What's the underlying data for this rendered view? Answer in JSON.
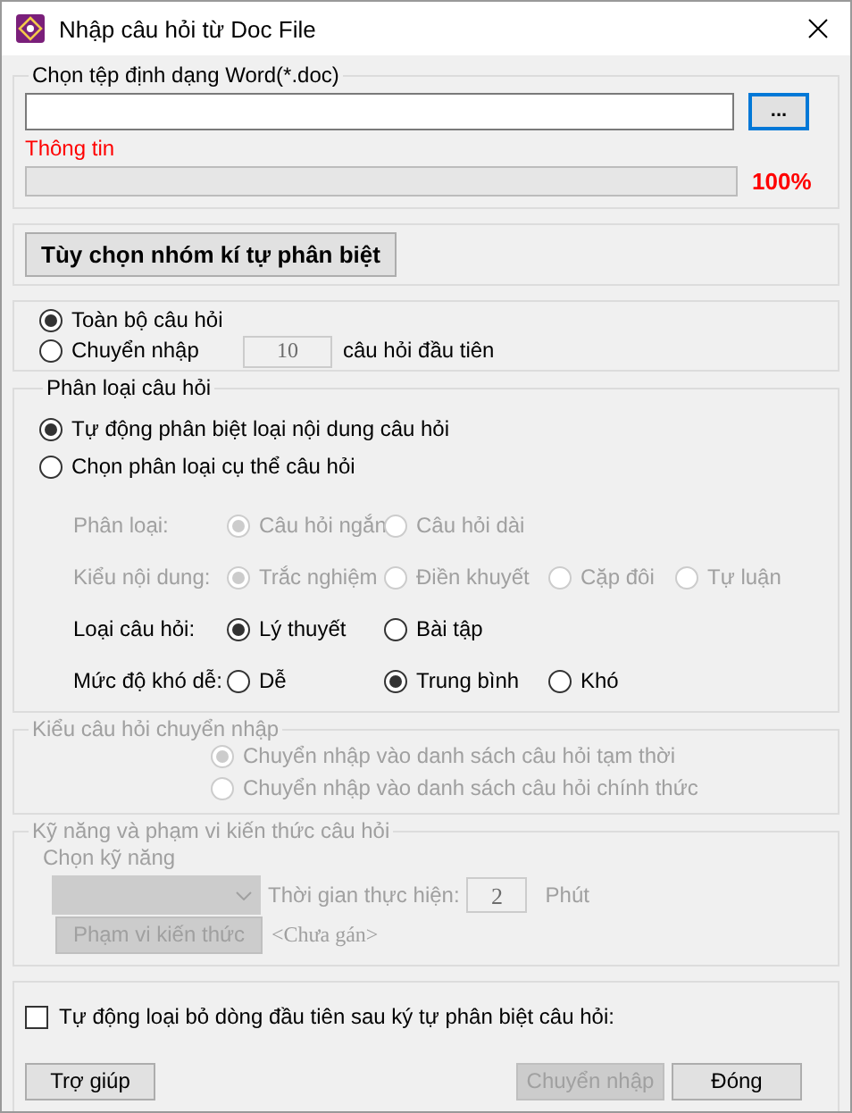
{
  "window": {
    "title": "Nhập câu hỏi từ Doc File"
  },
  "file_group": {
    "legend": "Chọn tệp định dạng Word(*.doc)",
    "browse_button": "...",
    "info_label": "Thông tin",
    "progress": {
      "reading": "100%"
    }
  },
  "options_button": {
    "label": "Tùy chọn nhóm kí tự phân biệt"
  },
  "scope": [
    {
      "label": "Toàn bộ câu hỏi",
      "selected": true
    },
    {
      "label": "Chuyển nhập",
      "selected": false,
      "count": "10",
      "suffix": "câu hỏi đầu tiên"
    }
  ],
  "classification": {
    "legend": "Phân loại câu hỏi",
    "modes": [
      {
        "label": "Tự động phân biệt loại nội dung câu hỏi",
        "selected": true
      },
      {
        "label": "Chọn phân loại cụ thể câu hỏi",
        "selected": false
      }
    ],
    "rows": [
      {
        "label": "Phân loại:",
        "disabled": true,
        "options": [
          {
            "label": "Câu hỏi ngắn",
            "selected": true
          },
          {
            "label": "Câu hỏi dài",
            "selected": false
          }
        ]
      },
      {
        "label": "Kiểu nội dung:",
        "disabled": true,
        "options": [
          {
            "label": "Trắc nghiệm",
            "selected": true
          },
          {
            "label": "Điền khuyết",
            "selected": false
          },
          {
            "label": "Cặp đôi",
            "selected": false
          },
          {
            "label": "Tự luận",
            "selected": false
          }
        ]
      },
      {
        "label": "Loại câu hỏi:",
        "disabled": false,
        "options": [
          {
            "label": "Lý thuyết",
            "selected": true
          },
          {
            "label": "Bài tập",
            "selected": false
          }
        ]
      },
      {
        "label": "Mức độ khó dễ:",
        "disabled": false,
        "options": [
          {
            "label": "Dễ",
            "selected": false
          },
          {
            "label": "Trung bình",
            "selected": true
          },
          {
            "label": "Khó",
            "selected": false
          }
        ]
      }
    ]
  },
  "import_type": {
    "legend": "Kiểu câu hỏi chuyển nhập",
    "disabled": true,
    "options": [
      {
        "label": "Chuyển nhập vào danh sách câu hỏi tạm thời",
        "selected": true
      },
      {
        "label": "Chuyển nhập vào danh sách câu hỏi chính thức",
        "selected": false
      }
    ]
  },
  "skills": {
    "legend": "Kỹ năng và phạm vi kiến thức câu hỏi",
    "disabled": true,
    "skill_label": "Chọn kỹ năng",
    "time_label": "Thời gian thực hiện:",
    "time_value": "2",
    "time_unit": "Phút",
    "scope_button": "Phạm vi kiến thức",
    "scope_value": "<Chưa gán>"
  },
  "auto_remove": {
    "label": "Tự động loại bỏ dòng đầu tiên sau ký tự phân biệt câu hỏi:",
    "checked": false
  },
  "buttons": [
    {
      "label": "Trợ giúp",
      "disabled": false
    },
    {
      "label": "Chuyển nhập",
      "disabled": true
    },
    {
      "label": "Đóng",
      "disabled": false
    }
  ]
}
